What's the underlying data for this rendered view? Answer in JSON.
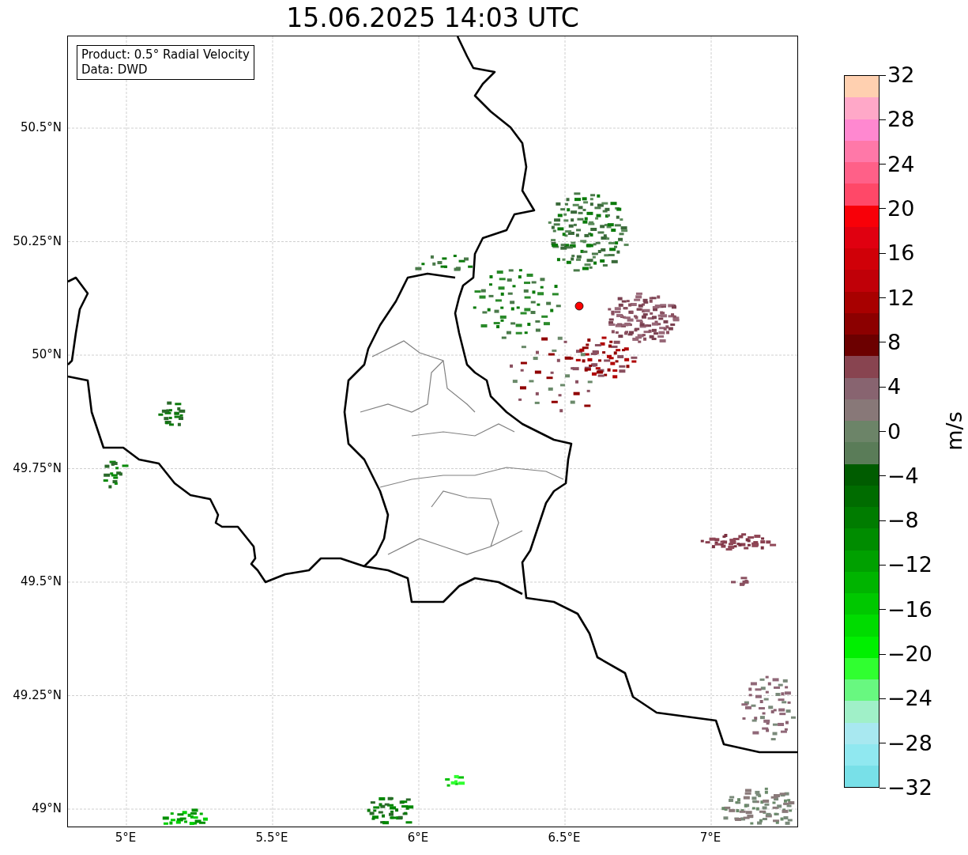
{
  "title": "15.06.2025 14:03 UTC",
  "legend": [
    "Product: 0.5° Radial Velocity",
    "Data: DWD"
  ],
  "lat_ticks": [
    "50.5°N",
    "50.25°N",
    "50°N",
    "49.75°N",
    "49.5°N",
    "49.25°N",
    "49°N"
  ],
  "lon_ticks": [
    "5°E",
    "5.5°E",
    "6°E",
    "6.5°E",
    "7°E"
  ],
  "colorbar": {
    "label": "m/s",
    "ticks": [
      "32",
      "28",
      "24",
      "20",
      "16",
      "12",
      "8",
      "4",
      "0",
      "−4",
      "−8",
      "−12",
      "−16",
      "−20",
      "−24",
      "−28",
      "−32"
    ],
    "segments": [
      {
        "color": "#ffd0b0"
      },
      {
        "color": "#ffa8c8"
      },
      {
        "color": "#ff88d0"
      },
      {
        "color": "#ff78a8"
      },
      {
        "color": "#ff6088"
      },
      {
        "color": "#ff4868"
      },
      {
        "color": "#f80008"
      },
      {
        "color": "#e00010"
      },
      {
        "color": "#d00008"
      },
      {
        "color": "#c00008"
      },
      {
        "color": "#a80000"
      },
      {
        "color": "#8c0000"
      },
      {
        "color": "#6c0000"
      },
      {
        "color": "#884450"
      },
      {
        "color": "#886470"
      },
      {
        "color": "#887878"
      },
      {
        "color": "#6c8468"
      },
      {
        "color": "#5a7c58"
      },
      {
        "color": "#005c00"
      },
      {
        "color": "#006c00"
      },
      {
        "color": "#007c00"
      },
      {
        "color": "#008c00"
      },
      {
        "color": "#00a000"
      },
      {
        "color": "#00b400"
      },
      {
        "color": "#00c800"
      },
      {
        "color": "#00dc00"
      },
      {
        "color": "#00f000"
      },
      {
        "color": "#30ff30"
      },
      {
        "color": "#68f880"
      },
      {
        "color": "#a0f0c8"
      },
      {
        "color": "#a8e8f0"
      },
      {
        "color": "#90e8f0"
      },
      {
        "color": "#78e0e8"
      }
    ]
  }
}
